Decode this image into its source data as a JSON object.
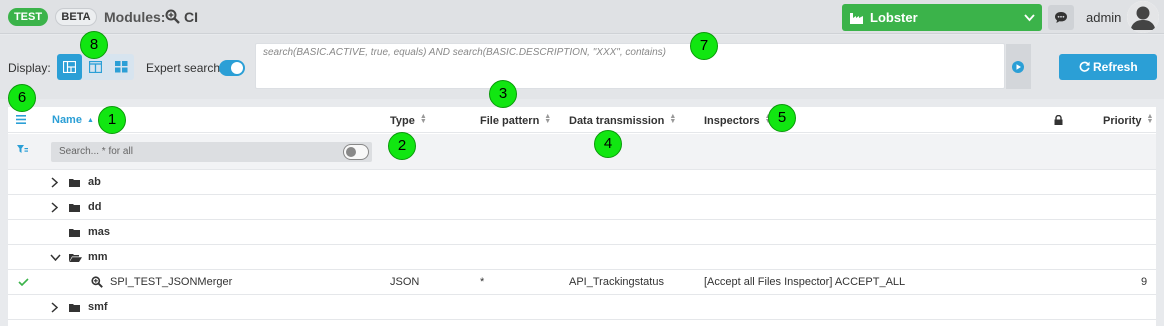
{
  "header": {
    "test_badge": "TEST",
    "beta_badge": "BETA",
    "modules_label": "Modules:",
    "module_name": "CI",
    "tenant_select": "Lobster",
    "user_name": "admin"
  },
  "toolbar": {
    "display_label": "Display:",
    "expert_search_label": "Expert search",
    "expert_search_enabled": true,
    "search_query": "search(BASIC.ACTIVE, true, equals) AND search(BASIC.DESCRIPTION, \"XXX\", contains)",
    "refresh_label": "Refresh"
  },
  "table": {
    "columns": {
      "name": "Name",
      "type": "Type",
      "file_pattern": "File pattern",
      "data_transmission": "Data transmission",
      "inspectors": "Inspectors",
      "priority": "Priority"
    },
    "filter_placeholder": "Search... * for all",
    "folders": {
      "ab": "ab",
      "dd": "dd",
      "mas": "mas",
      "mm": "mm",
      "smf": "smf"
    },
    "item": {
      "name": "SPI_TEST_JSONMerger",
      "type": "JSON",
      "file_pattern": "*",
      "data_transmission": "API_Trackingstatus",
      "inspectors": "[Accept all Files Inspector] ACCEPT_ALL",
      "priority": "9"
    }
  },
  "markers": [
    "1",
    "2",
    "3",
    "4",
    "5",
    "6",
    "7",
    "8"
  ],
  "colors": {
    "accent_blue": "#2b9fd6",
    "brand_green": "#3bb34a",
    "marker_green": "#11e611"
  },
  "icons": [
    "search-zoom-icon",
    "factory-icon",
    "chevron-down-icon",
    "chat-icon",
    "user-avatar-icon",
    "tree-view-icon",
    "split-view-icon",
    "grid-view-icon",
    "play-icon",
    "refresh-icon",
    "hamburger-menu-icon",
    "lock-icon",
    "filter-icon",
    "chevron-right-icon",
    "folder-icon",
    "check-icon"
  ]
}
